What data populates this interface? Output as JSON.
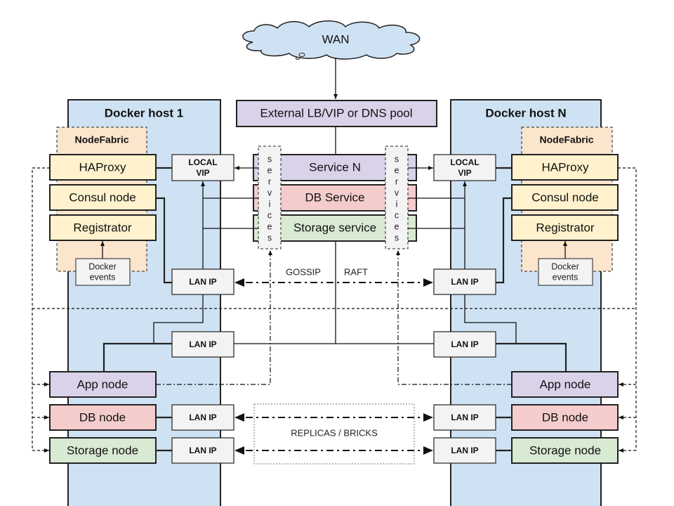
{
  "wan": "WAN",
  "external_lb": "External LB/VIP or DNS pool",
  "hosts": [
    "Docker host 1",
    "Docker host N"
  ],
  "nodefabric": "NodeFabric",
  "haproxy": "HAProxy",
  "consul": "Consul node",
  "registrator": "Registrator",
  "docker_events": [
    "Docker",
    "events"
  ],
  "local_vip": [
    "LOCAL",
    "VIP"
  ],
  "lan_ip": "LAN IP",
  "services_vertical": [
    "s",
    "e",
    "r",
    "v",
    "i",
    "c",
    "e",
    "s"
  ],
  "service_n": "Service N",
  "db_service": "DB Service",
  "storage_service": "Storage service",
  "gossip": "GOSSIP",
  "raft": "RAFT",
  "app_node": "App node",
  "db_node": "DB node",
  "storage_node": "Storage node",
  "replicas": "REPLICAS / BRICKS",
  "colors": {
    "host": "#cfe2f3",
    "nodefabric": "#fce5cd",
    "yellow": "#fff2cc",
    "purple": "#d9d2e9",
    "red": "#f4cccc",
    "green": "#d9ead3",
    "gray": "#f3f3f3",
    "cloud": "#cfe2f3"
  }
}
